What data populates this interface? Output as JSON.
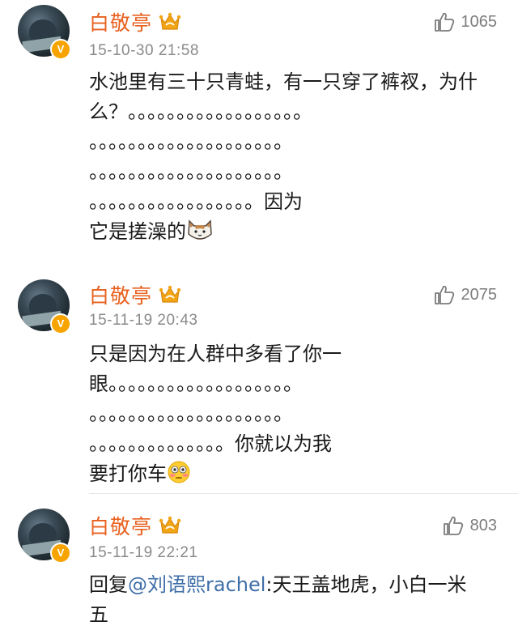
{
  "comments": [
    {
      "username": "白敬亭",
      "verified_badge": "V",
      "timestamp": "15-10-30 21:58",
      "likes": "1065",
      "text": "水池里有三十只青蛙，有一只穿了裤衩，为什\n么？。。。。。。。。。。。。。。。。。。\n。。。。。。。。。。。。。。。。。。。。\n。。。。。。。。。。。。。。。。。。。。\n。。。。。。。。。。。。。。。。。因为\n它是搓澡的",
      "emoji": "cat-emoji"
    },
    {
      "username": "白敬亭",
      "verified_badge": "V",
      "timestamp": "15-11-19 20:43",
      "likes": "2075",
      "text": "只是因为在人群中多看了你一\n眼。。。。。。。。。。。。。。。。。。。\n。。。。。。。。。。。。。。。。。。。。\n。。。。。。。。。。。。。。你就以为我\n要打你车",
      "emoji": "flushed-emoji"
    },
    {
      "username": "白敬亭",
      "verified_badge": "V",
      "timestamp": "15-11-19 22:21",
      "likes": "803",
      "reply_prefix": "回复",
      "mention": "@刘语熙rachel",
      "text": ":天王盖地虎，小白一米\n五"
    }
  ],
  "colors": {
    "username": "#e8611f",
    "mention": "#3e6ea8",
    "badge": "#f7a400"
  },
  "icons": {
    "like": "thumbs-up-icon",
    "member": "crown-icon"
  }
}
